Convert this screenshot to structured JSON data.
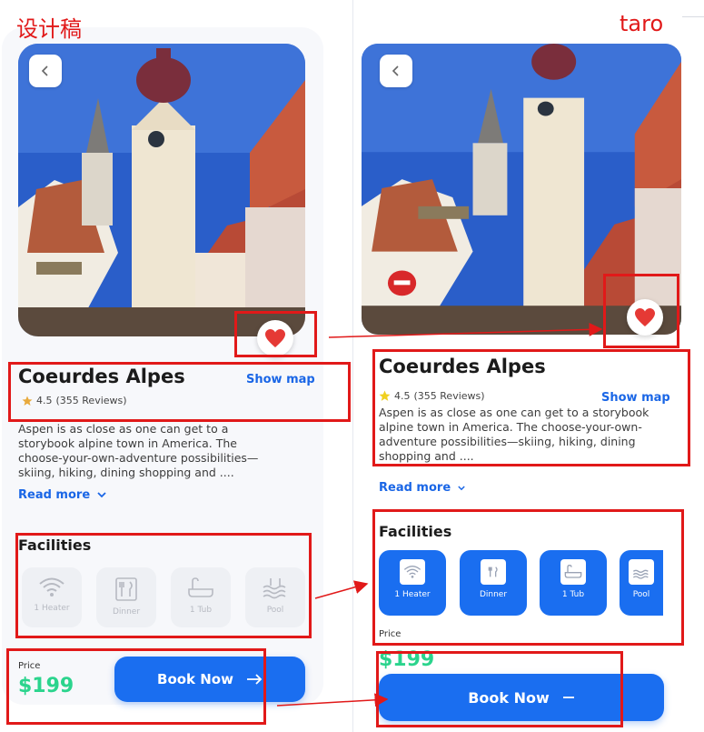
{
  "labels": {
    "design": "设计稿",
    "taro": "taro"
  },
  "place": {
    "title": "Coeurdes Alpes",
    "show_map": "Show map",
    "rating": "4.5",
    "reviews": "(355 Reviews)",
    "description": "Aspen is as close as one can get to a storybook alpine town in America. The choose-your-own-adventure possibilities—skiing, hiking, dining shopping and ....",
    "read_more": "Read more"
  },
  "facilities": {
    "heading": "Facilities",
    "items": [
      {
        "label": "1 Heater",
        "icon": "wifi-icon"
      },
      {
        "label": "Dinner",
        "icon": "fork-knife-icon"
      },
      {
        "label": "1 Tub",
        "icon": "bathtub-icon"
      },
      {
        "label": "Pool",
        "icon": "pool-icon"
      }
    ]
  },
  "booking": {
    "price_label": "Price",
    "price": "$199",
    "cta": "Book Now"
  },
  "colors": {
    "accent": "#1a6ef0",
    "price": "#2bd48d",
    "annotation": "#e11919",
    "heart": "#e53935",
    "star": "#e8a93c"
  }
}
